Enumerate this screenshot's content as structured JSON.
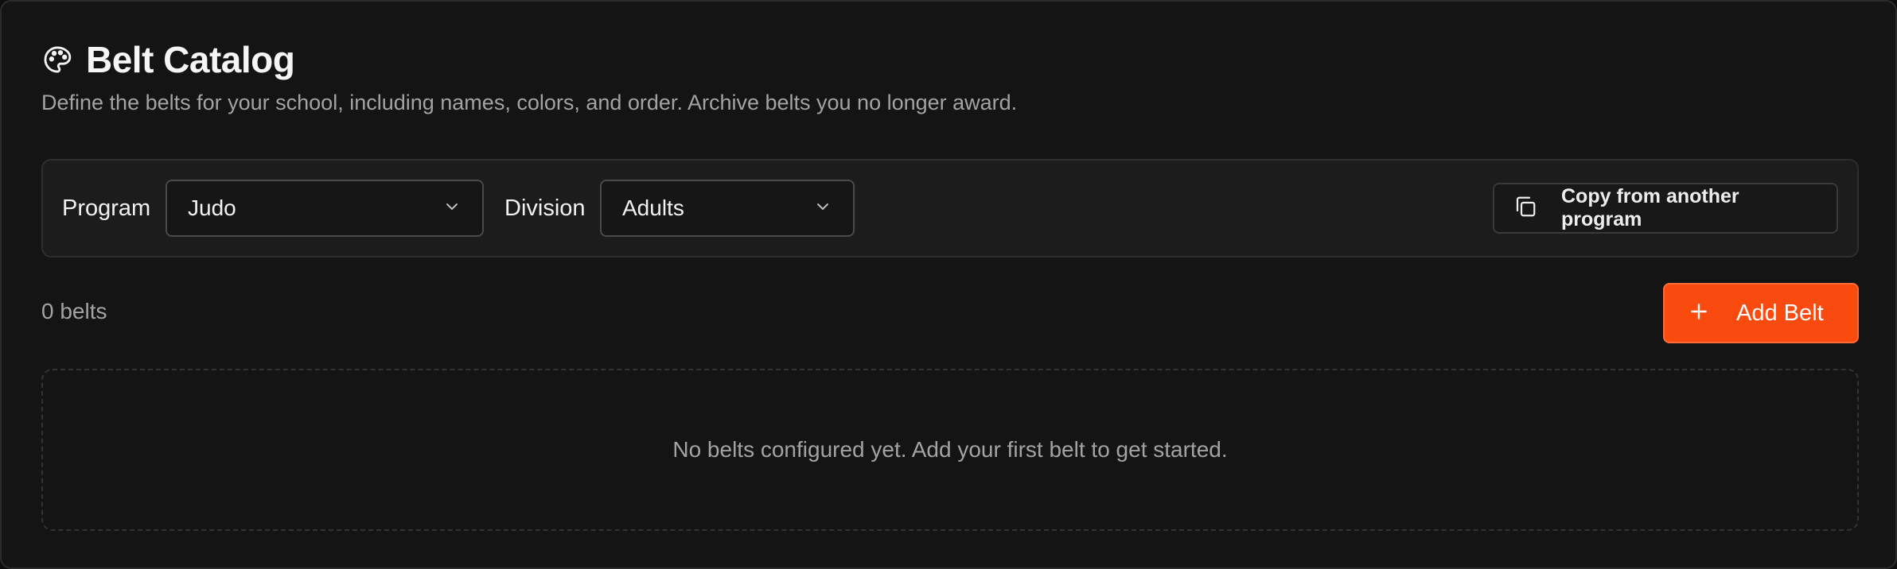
{
  "header": {
    "icon": "palette-icon",
    "title": "Belt Catalog",
    "subtitle": "Define the belts for your school, including names, colors, and order. Archive belts you no longer award."
  },
  "filters": {
    "program_label": "Program",
    "program_value": "Judo",
    "division_label": "Division",
    "division_value": "Adults",
    "copy_button_label": "Copy from another program",
    "copy_icon": "copy-icon"
  },
  "summary": {
    "count_text": "0 belts",
    "add_button_label": "Add Belt",
    "add_icon": "plus-icon"
  },
  "empty_state": {
    "message": "No belts configured yet. Add your first belt to get started."
  },
  "colors": {
    "accent": "#f94a0f",
    "background": "#141414",
    "panel": "#1c1c1c"
  }
}
